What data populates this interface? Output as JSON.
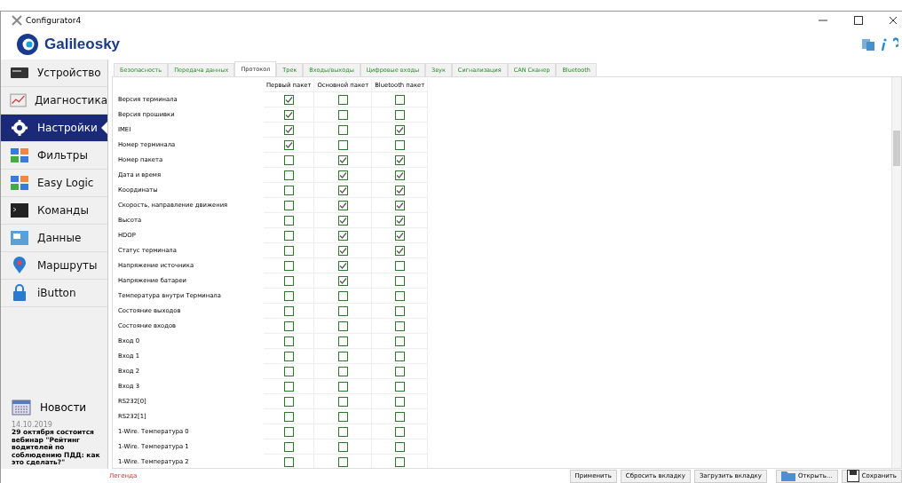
{
  "window": {
    "title": "Configurator4"
  },
  "logo": {
    "text": "Galileosky"
  },
  "sidebar": {
    "items": [
      {
        "label": "Устройство",
        "kind": "device",
        "selected": false
      },
      {
        "label": "Диагностика",
        "kind": "chart",
        "selected": false
      },
      {
        "label": "Настройки",
        "kind": "gear",
        "selected": true
      },
      {
        "label": "Фильтры",
        "kind": "puzzle",
        "selected": false
      },
      {
        "label": "Easy Logic",
        "kind": "puzzle",
        "selected": false
      },
      {
        "label": "Команды",
        "kind": "terminal",
        "selected": false
      },
      {
        "label": "Данные",
        "kind": "data",
        "selected": false
      },
      {
        "label": "Маршруты",
        "kind": "pin",
        "selected": false
      },
      {
        "label": "iButton",
        "kind": "lock",
        "selected": false
      }
    ]
  },
  "news": {
    "title": "Новости",
    "date": "14.10.2019",
    "headline": "29 октября состоится вебинар \"Рейтинг водителей по соблюдению ПДД: как это сделать?\""
  },
  "tabs": [
    {
      "label": "Безопасность",
      "selected": false
    },
    {
      "label": "Передача данных",
      "selected": false
    },
    {
      "label": "Протокол",
      "selected": true
    },
    {
      "label": "Трек",
      "selected": false
    },
    {
      "label": "Входы/выходы",
      "selected": false
    },
    {
      "label": "Цифровые входы",
      "selected": false
    },
    {
      "label": "Звук",
      "selected": false
    },
    {
      "label": "Сигнализация",
      "selected": false
    },
    {
      "label": "CAN Сканер",
      "selected": false
    },
    {
      "label": "Bluetooth",
      "selected": false
    }
  ],
  "table": {
    "columns": [
      "Первый пакет",
      "Основной пакет",
      "Bluetooth пакет"
    ],
    "rows": [
      {
        "name": "Версия терминала",
        "checks": [
          true,
          false,
          false
        ]
      },
      {
        "name": "Версия прошивки",
        "checks": [
          true,
          false,
          false
        ]
      },
      {
        "name": "IMEI",
        "checks": [
          true,
          false,
          true
        ]
      },
      {
        "name": "Номер терминала",
        "checks": [
          true,
          false,
          false
        ]
      },
      {
        "name": "Номер пакета",
        "checks": [
          false,
          true,
          true
        ]
      },
      {
        "name": "Дата и время",
        "checks": [
          false,
          true,
          true
        ]
      },
      {
        "name": "Координаты",
        "checks": [
          false,
          true,
          true
        ]
      },
      {
        "name": "Скорость, направление движения",
        "checks": [
          false,
          true,
          true
        ]
      },
      {
        "name": "Высота",
        "checks": [
          false,
          true,
          true
        ]
      },
      {
        "name": "HDOP",
        "checks": [
          false,
          true,
          true
        ]
      },
      {
        "name": "Статус терминала",
        "checks": [
          false,
          true,
          true
        ]
      },
      {
        "name": "Напряжение источника",
        "checks": [
          false,
          true,
          false
        ]
      },
      {
        "name": "Напряжение батареи",
        "checks": [
          false,
          true,
          false
        ]
      },
      {
        "name": "Температура внутри Терминала",
        "checks": [
          false,
          false,
          false
        ]
      },
      {
        "name": "Состояние выходов",
        "checks": [
          false,
          false,
          false
        ]
      },
      {
        "name": "Состояние входов",
        "checks": [
          false,
          false,
          false
        ]
      },
      {
        "name": "Вход 0",
        "checks": [
          false,
          false,
          false
        ]
      },
      {
        "name": "Вход 1",
        "checks": [
          false,
          false,
          false
        ]
      },
      {
        "name": "Вход 2",
        "checks": [
          false,
          false,
          false
        ]
      },
      {
        "name": "Вход 3",
        "checks": [
          false,
          false,
          false
        ]
      },
      {
        "name": "RS232[0]",
        "checks": [
          false,
          false,
          false
        ]
      },
      {
        "name": "RS232[1]",
        "checks": [
          false,
          false,
          false
        ]
      },
      {
        "name": "1-Wire. Температура 0",
        "checks": [
          false,
          false,
          false
        ]
      },
      {
        "name": "1-Wire. Температура 1",
        "checks": [
          false,
          false,
          false
        ]
      },
      {
        "name": "1-Wire. Температура 2",
        "checks": [
          false,
          false,
          false
        ]
      }
    ]
  },
  "status_bar": {
    "legend": "Легенда",
    "buttons": [
      {
        "label": "Применить",
        "kind": "plain"
      },
      {
        "label": "Сбросить вкладку",
        "kind": "plain"
      },
      {
        "label": "Загрузить вкладку",
        "kind": "plain"
      },
      {
        "label": "Открыть...",
        "kind": "open"
      },
      {
        "label": "Сохранить",
        "kind": "save"
      }
    ]
  }
}
